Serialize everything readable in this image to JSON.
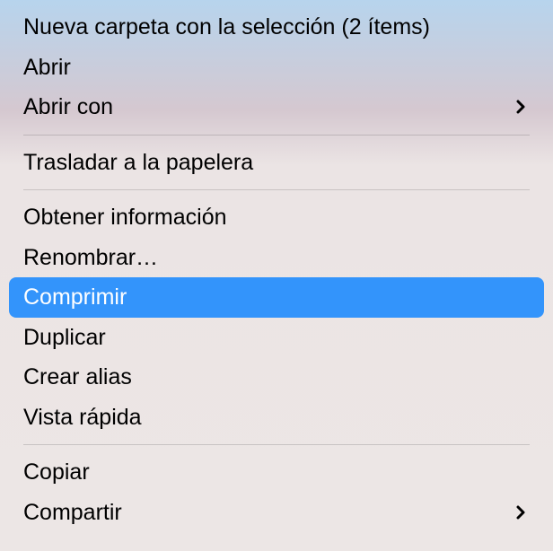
{
  "menu": {
    "groups": [
      {
        "items": [
          {
            "id": "new-folder-selection",
            "label": "Nueva carpeta con la selección (2 ítems)",
            "submenu": false,
            "highlighted": false
          },
          {
            "id": "open",
            "label": "Abrir",
            "submenu": false,
            "highlighted": false
          },
          {
            "id": "open-with",
            "label": "Abrir con",
            "submenu": true,
            "highlighted": false
          }
        ]
      },
      {
        "items": [
          {
            "id": "move-to-trash",
            "label": "Trasladar a la papelera",
            "submenu": false,
            "highlighted": false
          }
        ]
      },
      {
        "items": [
          {
            "id": "get-info",
            "label": "Obtener información",
            "submenu": false,
            "highlighted": false
          },
          {
            "id": "rename",
            "label": "Renombrar…",
            "submenu": false,
            "highlighted": false
          },
          {
            "id": "compress",
            "label": "Comprimir",
            "submenu": false,
            "highlighted": true
          },
          {
            "id": "duplicate",
            "label": "Duplicar",
            "submenu": false,
            "highlighted": false
          },
          {
            "id": "make-alias",
            "label": "Crear alias",
            "submenu": false,
            "highlighted": false
          },
          {
            "id": "quick-look",
            "label": "Vista rápida",
            "submenu": false,
            "highlighted": false
          }
        ]
      },
      {
        "items": [
          {
            "id": "copy",
            "label": "Copiar",
            "submenu": false,
            "highlighted": false
          },
          {
            "id": "share",
            "label": "Compartir",
            "submenu": true,
            "highlighted": false
          }
        ]
      }
    ]
  }
}
